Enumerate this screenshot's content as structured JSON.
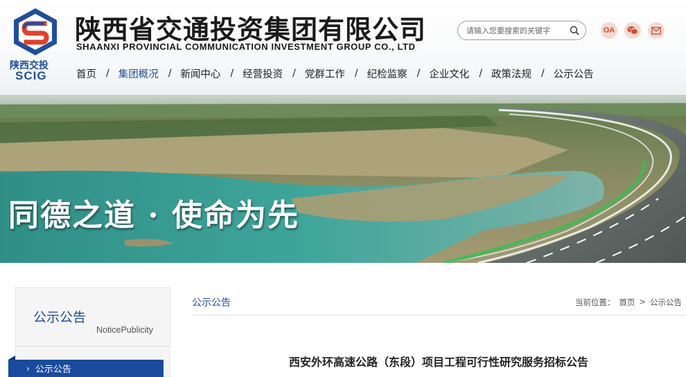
{
  "header": {
    "logo_cn": "陕西交投",
    "logo_en": "SCIG",
    "brand_cn": "陕西省交通投资集团有限公司",
    "brand_en": "SHAANXI PROVINCIAL COMMUNICATION INVESTMENT GROUP CO., LTD",
    "search_placeholder": "请输入您要搜索的关键字",
    "oa_label": "OA",
    "icons": [
      "search-icon",
      "wechat-icon",
      "mail-icon"
    ]
  },
  "nav": {
    "items": [
      {
        "label": "首页"
      },
      {
        "label": "集团概况",
        "active": true
      },
      {
        "label": "新闻中心"
      },
      {
        "label": "经营投资"
      },
      {
        "label": "党群工作"
      },
      {
        "label": "纪检监察"
      },
      {
        "label": "企业文化"
      },
      {
        "label": "政策法规"
      },
      {
        "label": "公示公告"
      }
    ],
    "separator": "/"
  },
  "banner": {
    "slogan": "同德之道 · 使命为先"
  },
  "sidebar": {
    "title": "公示公告",
    "subtitle": "NoticePublicity",
    "menu": [
      {
        "label": "公示公告",
        "arrow": "›"
      }
    ]
  },
  "main": {
    "section_title": "公示公告",
    "breadcrumb": {
      "prefix": "当前位置：",
      "items": [
        "首页",
        ">",
        "公示公告"
      ]
    },
    "article_title": "西安外环高速公路（东段）项目工程可行性研究服务招标公告"
  },
  "colors": {
    "brand_blue": "#1f4e9d",
    "logo_red": "#e2402a",
    "icon_bg": "#f3d9d4",
    "icon_red": "#d94a2b",
    "menu_blue": "#1a4a9c"
  }
}
